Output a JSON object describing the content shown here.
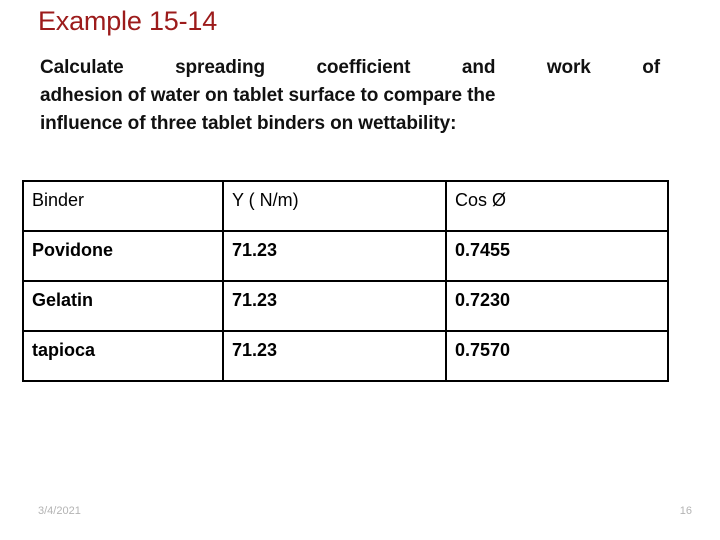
{
  "slide": {
    "title": "Example 15-14",
    "title_color": "#9C1B1B",
    "body": {
      "line1": "Calculate spreading coefficient and work of",
      "line2": "adhesion of water on tablet surface  to compare the",
      "line3": "influence of three tablet binders on wettability:"
    }
  },
  "table": {
    "headers": {
      "binder": "Binder",
      "gamma": "Y ( N/m)",
      "cos": "Cos Ø"
    },
    "rows": [
      {
        "binder": "Povidone",
        "gamma": "71.23",
        "cos": "0.7455"
      },
      {
        "binder": "Gelatin",
        "gamma": "71.23",
        "cos": "0.7230"
      },
      {
        "binder": "tapioca",
        "gamma": "71.23",
        "cos": "0.7570"
      }
    ]
  },
  "footer": {
    "date": "3/4/2021",
    "page_number": "16"
  }
}
